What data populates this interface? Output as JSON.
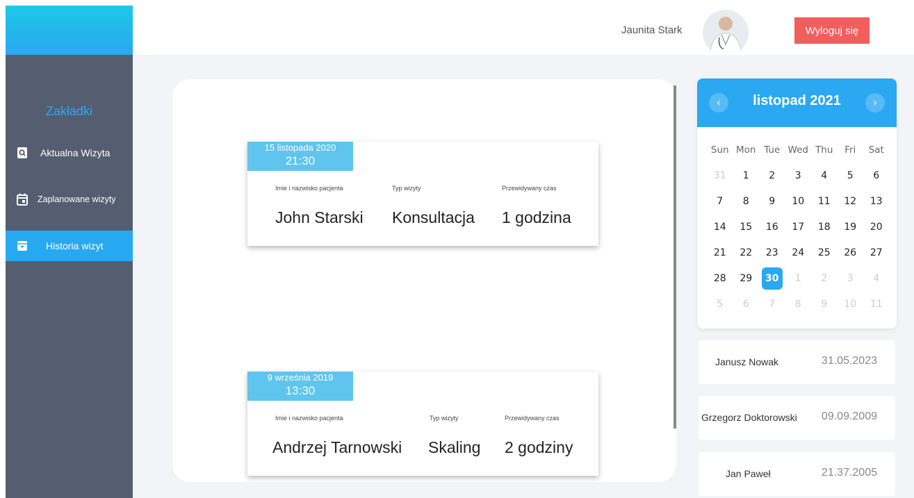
{
  "sidebar": {
    "heading": "Zakładki",
    "items": [
      {
        "label": "Aktualna Wizyta"
      },
      {
        "label": "Zaplanowane wizyty"
      },
      {
        "label": "Historia wizyt"
      }
    ]
  },
  "header": {
    "user_name": "Jaunita Stark",
    "logout_label": "Wyloguj się"
  },
  "visits": [
    {
      "date": "15 listopada 2020",
      "time": "21:30",
      "label_patient": "Imie i nazwisko pacjenta",
      "label_type": "Typ wizyty",
      "label_duration": "Przewidywany czas",
      "patient": "John Starski",
      "type": "Konsultacja",
      "duration": "1 godzina"
    },
    {
      "date": "9 września 2019",
      "time": "13:30",
      "label_patient": "Imie i nazwisko pacjenta",
      "label_type": "Typ wizyty",
      "label_duration": "Przewidywany czas",
      "patient": "Andrzej Tarnowski",
      "type": "Skaling",
      "duration": "2 godziny"
    }
  ],
  "calendar": {
    "title": "listopad 2021",
    "prev": "‹",
    "next": "›",
    "weekdays": [
      "Sun",
      "Mon",
      "Tue",
      "Wed",
      "Thu",
      "Fri",
      "Sat"
    ],
    "weeks": [
      [
        "31",
        "1",
        "2",
        "3",
        "4",
        "5",
        "6"
      ],
      [
        "7",
        "8",
        "9",
        "10",
        "11",
        "12",
        "13"
      ],
      [
        "14",
        "15",
        "16",
        "17",
        "18",
        "19",
        "20"
      ],
      [
        "21",
        "22",
        "23",
        "24",
        "25",
        "26",
        "27"
      ],
      [
        "28",
        "29",
        "30",
        "1",
        "2",
        "3",
        "4"
      ],
      [
        "5",
        "6",
        "7",
        "8",
        "9",
        "10",
        "11"
      ]
    ],
    "selected_day": "30"
  },
  "list": [
    {
      "name": "Janusz Nowak",
      "date": "31.05.2023"
    },
    {
      "name": "Grzegorz Doktorowski",
      "date": "09.09.2009"
    },
    {
      "name": "Jan Paweł",
      "date": "21.37.2005"
    }
  ],
  "colors": {
    "accent": "#2aa8f2",
    "sidebar": "#555d70",
    "logout": "#f25d5d",
    "date_badge": "#5fc4ee"
  }
}
